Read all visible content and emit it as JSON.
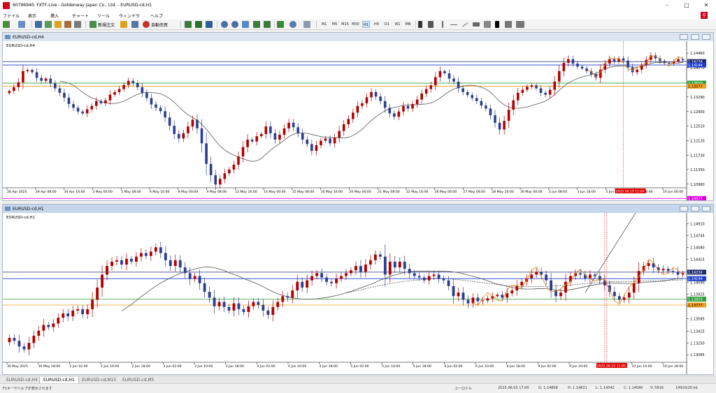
{
  "window": {
    "title": "60796940: FXTF-Live - Goldenway Japan Co., Ltd. - EURUSD-cd,H1"
  },
  "menu": [
    "ファイル",
    "表示",
    "挿入",
    "チャート",
    "ツール",
    "ウィンドウ",
    "ヘルプ"
  ],
  "toolbar": {
    "new_order": "新規注文",
    "auto_trade": "自動売買",
    "timeframes": [
      "M1",
      "M5",
      "M15",
      "M30",
      "H1",
      "H4",
      "D1",
      "W1",
      "MN"
    ],
    "selected_timeframe": "H1"
  },
  "chart_data": [
    {
      "type": "candlestick",
      "window_title": "EURUSD-cd,H4",
      "label": "EURUSD-cd,H4",
      "y_ticks": [
        "1.14460",
        "1.14070",
        "1.13680",
        "1.13290",
        "1.12900",
        "1.12510",
        "1.12120",
        "1.11730",
        "1.11350",
        "1.10960"
      ],
      "price_tags": {
        "blue": "1.14144",
        "dark": "1.14234",
        "green": "1.13659",
        "orange": "1.13577",
        "magenta": "1.10577"
      },
      "x_ticks": [
        "28 Apr 2025",
        "29 Apr 08:00",
        "30 Apr 16:00",
        "2 May 00:00",
        "5 May 08:00",
        "6 May 16:00",
        "8 May 00:00",
        "9 May 08:00",
        "12 May 16:00",
        "14 May 00:00",
        "15 May 08:00",
        "16 May 16:00",
        "20 May 00:00",
        "21 May 08:00",
        "22 May 16:00",
        "26 May 00:00",
        "27 May 08:00",
        "28 May 16:00",
        "30 May 00:00",
        "2 Jun 08:00",
        "3 Jun 16:00",
        "5 Jun 00:00",
        "6 Jun 08:00",
        "10 Jun 00:00"
      ],
      "cursor_time": "2025.06.10 11:00",
      "ylim": [
        1.109,
        1.1463
      ],
      "closes": [
        1.1345,
        1.1355,
        1.1368,
        1.1398,
        1.1401,
        1.1395,
        1.138,
        1.1372,
        1.1378,
        1.1365,
        1.1352,
        1.134,
        1.1327,
        1.131,
        1.13,
        1.129,
        1.1285,
        1.1296,
        1.1305,
        1.1318,
        1.1312,
        1.132,
        1.1335,
        1.1342,
        1.135,
        1.1361,
        1.1372,
        1.1366,
        1.1355,
        1.134,
        1.1326,
        1.1309,
        1.13,
        1.1291,
        1.1274,
        1.1252,
        1.123,
        1.1218,
        1.1232,
        1.125,
        1.1268,
        1.1245,
        1.1205,
        1.115,
        1.112,
        1.1095,
        1.111,
        1.1125,
        1.1135,
        1.1148,
        1.117,
        1.1195,
        1.1215,
        1.121,
        1.1224,
        1.123,
        1.125,
        1.1232,
        1.1215,
        1.1228,
        1.1245,
        1.126,
        1.1248,
        1.1232,
        1.1215,
        1.1203,
        1.1185,
        1.12,
        1.1212,
        1.1218,
        1.1205,
        1.122,
        1.1238,
        1.1256,
        1.127,
        1.1287,
        1.1305,
        1.1312,
        1.1328,
        1.1342,
        1.133,
        1.1318,
        1.13,
        1.1285,
        1.1276,
        1.129,
        1.1305,
        1.1298,
        1.131,
        1.1322,
        1.1338,
        1.135,
        1.136,
        1.1382,
        1.1398,
        1.1392,
        1.1378,
        1.137,
        1.1352,
        1.1342,
        1.1334,
        1.1326,
        1.1318,
        1.1306,
        1.1298,
        1.128,
        1.126,
        1.1242,
        1.1265,
        1.1295,
        1.132,
        1.134,
        1.1348,
        1.1356,
        1.136,
        1.1352,
        1.134,
        1.1335,
        1.1348,
        1.137,
        1.1398,
        1.142,
        1.143,
        1.1418,
        1.141,
        1.1405,
        1.1398,
        1.139,
        1.138,
        1.1402,
        1.1418,
        1.143,
        1.1424,
        1.1432,
        1.1426,
        1.1408,
        1.1395,
        1.1402,
        1.1415,
        1.1428,
        1.144,
        1.1432,
        1.1425,
        1.142,
        1.1418,
        1.1424,
        1.143,
        1.1427
      ]
    },
    {
      "type": "candlestick",
      "window_title": "EURUSD-cd,H1",
      "label": "EURUSD-cd,H1",
      "y_ticks": [
        "1.14910",
        "1.14745",
        "1.14580",
        "1.14415",
        "1.14250",
        "1.14090",
        "1.13925",
        "1.13760",
        "1.13585",
        "1.13415",
        "1.13250",
        "1.13085"
      ],
      "price_tags": {
        "dark": "1.14234",
        "blue": "1.14144",
        "green": "1.13859",
        "orange": "1.13777"
      },
      "x_ticks": [
        "30 May 2025",
        "30 May 18:00",
        "2 Jun 02:00",
        "2 Jun 10:00",
        "2 Jun 18:00",
        "3 Jun 02:00",
        "3 Jun 10:00",
        "3 Jun 18:00",
        "4 Jun 02:00",
        "4 Jun 10:00",
        "4 Jun 18:00",
        "5 Jun 02:00",
        "5 Jun 10:00",
        "5 Jun 18:00",
        "6 Jun 02:00",
        "6 Jun 10:00",
        "6 Jun 18:00",
        "9 Jun 02:00",
        "9 Jun 10:00",
        "9 Jun 18:00",
        "10 Jun 10:00",
        "10 Jun 18:00"
      ],
      "cursor_time": "2025.06.10 11:00",
      "ylim": [
        1.13,
        1.15
      ],
      "closes": [
        1.1332,
        1.1328,
        1.132,
        1.1316,
        1.1325,
        1.1335,
        1.1342,
        1.135,
        1.1347,
        1.1352,
        1.136,
        1.1366,
        1.1362,
        1.137,
        1.1372,
        1.1365,
        1.1372,
        1.1385,
        1.1402,
        1.142,
        1.1432,
        1.1438,
        1.144,
        1.1434,
        1.1442,
        1.1438,
        1.1445,
        1.145,
        1.1446,
        1.1452,
        1.1458,
        1.145,
        1.144,
        1.1432,
        1.144,
        1.143,
        1.1422,
        1.1414,
        1.1418,
        1.1408,
        1.1396,
        1.1388,
        1.1376,
        1.1382,
        1.1375,
        1.137,
        1.138,
        1.1372,
        1.1368,
        1.1376,
        1.1382,
        1.1378,
        1.137,
        1.1364,
        1.1375,
        1.1382,
        1.139,
        1.1388,
        1.1398,
        1.141,
        1.1402,
        1.1412,
        1.1418,
        1.1422,
        1.1416,
        1.141,
        1.1408,
        1.1414,
        1.1418,
        1.1422,
        1.1426,
        1.1432,
        1.1424,
        1.1434,
        1.144,
        1.1448,
        1.1445,
        1.142,
        1.1438,
        1.143,
        1.1438,
        1.1428,
        1.1422,
        1.1418,
        1.1416,
        1.1412,
        1.1418,
        1.142,
        1.1414,
        1.1412,
        1.1404,
        1.139,
        1.1395,
        1.1385,
        1.138,
        1.1388,
        1.1383,
        1.1384,
        1.1387,
        1.139,
        1.1392,
        1.1388,
        1.1394,
        1.1398,
        1.1405,
        1.141,
        1.1415,
        1.142,
        1.1424,
        1.142,
        1.1412,
        1.1398,
        1.139,
        1.1395,
        1.141,
        1.1418,
        1.1422,
        1.142,
        1.1415,
        1.142,
        1.1418,
        1.1412,
        1.1405,
        1.1396,
        1.139,
        1.1385,
        1.1388,
        1.1395,
        1.1408,
        1.1425,
        1.1432,
        1.1436,
        1.143,
        1.1426,
        1.1428,
        1.1425,
        1.1424,
        1.142,
        1.1422
      ]
    }
  ],
  "tabs": [
    "EURUSD-cd,H4",
    "EURUSD-cd,H1",
    "EURUSD-cd,M15",
    "EURUSD-cd,M5"
  ],
  "active_tab": "EURUSD-cd,H1",
  "status": {
    "help": "F1キーでヘルプが表示されます",
    "profile": "ユーロドル",
    "datetime": "2025.06.05 17:00",
    "open": "O: 1.14808",
    "high": "H: 1.14821",
    "low": "L: 1.14542",
    "close": "C: 1.14580",
    "volume": "V: 5816",
    "traffic": "14920/20 kb"
  }
}
